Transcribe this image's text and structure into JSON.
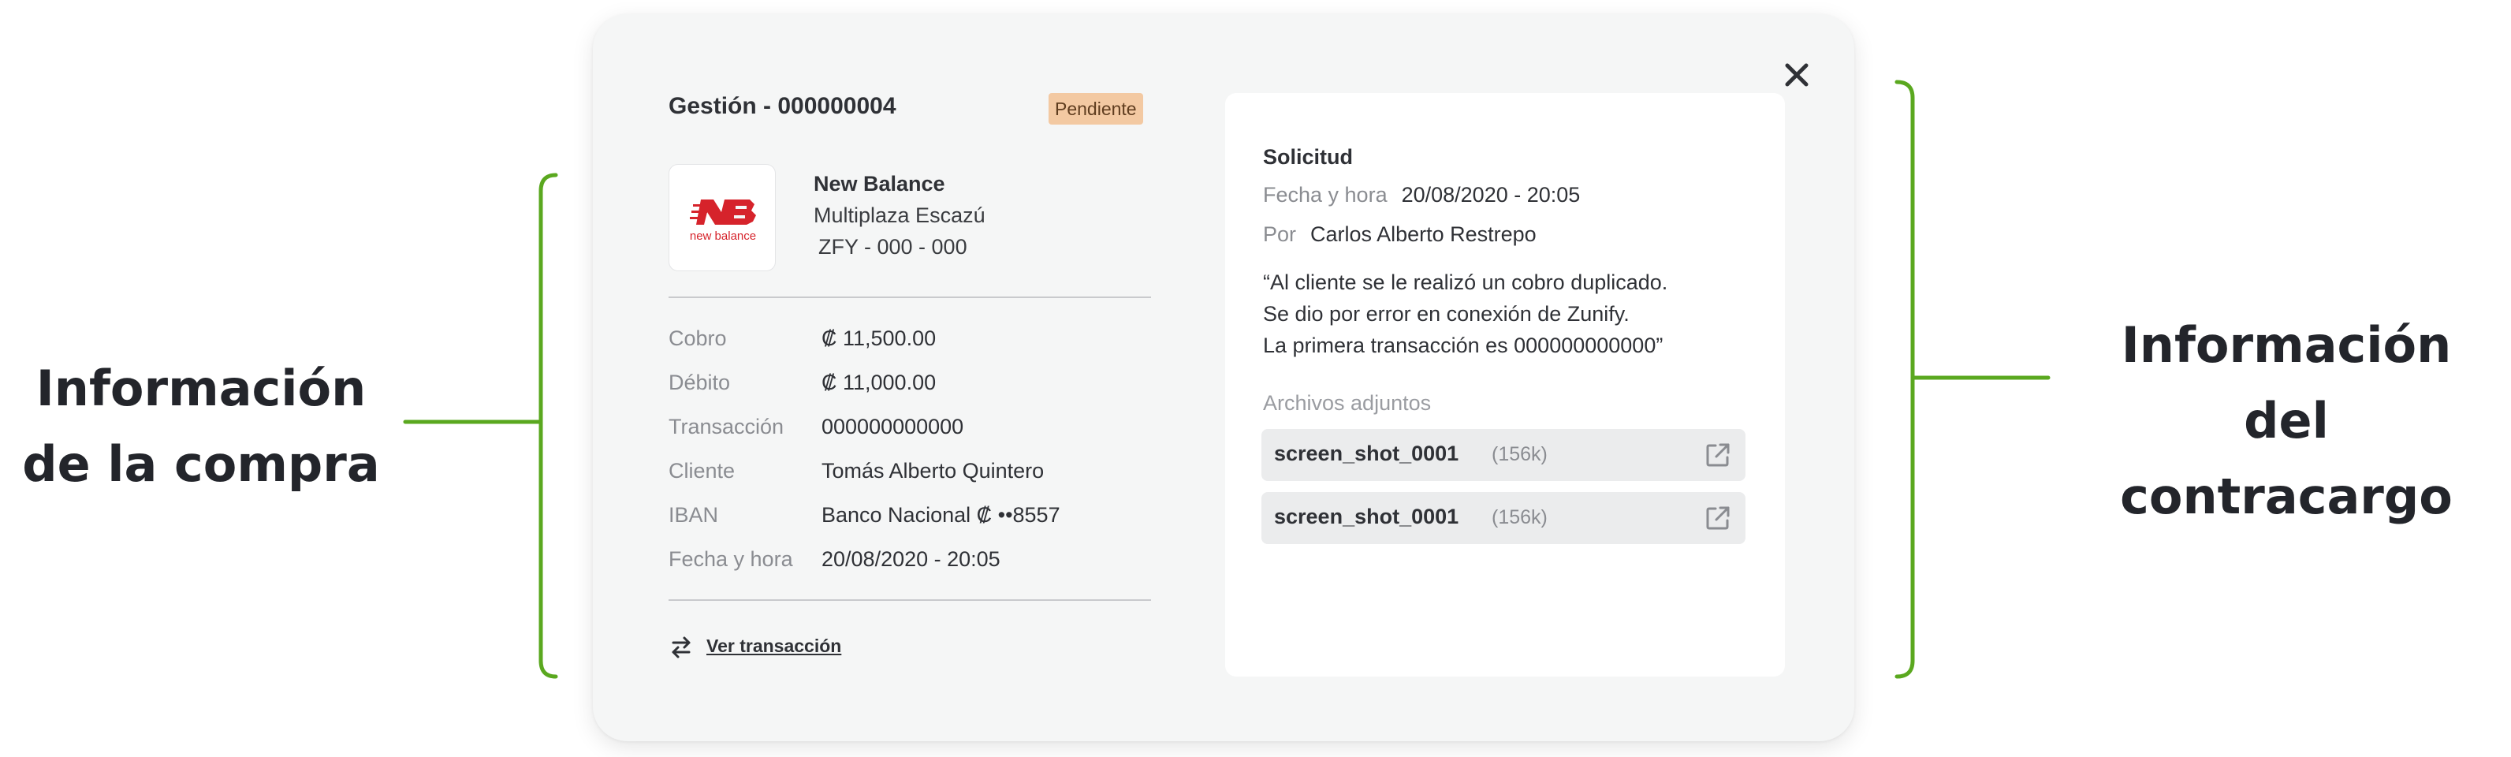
{
  "annotations": {
    "left_line1": "Información",
    "left_line2": "de la compra",
    "right_line1": "Información",
    "right_line2": "del contracargo",
    "bracket_color": "#5aa81f"
  },
  "modal": {
    "close_icon": "close-icon",
    "title": "Gestión - 000000004",
    "status_badge": "Pendiente",
    "merchant": {
      "logo_text": "new balance",
      "logo_mark": "NB",
      "name": "New Balance",
      "location": "Multiplaza Escazú",
      "code": "ZFY - 000 - 000"
    },
    "details": [
      {
        "label": "Cobro",
        "value": "₡ 11,500.00"
      },
      {
        "label": "Débito",
        "value": "₡ 11,000.00"
      },
      {
        "label": "Transacción",
        "value": "000000000000"
      },
      {
        "label": "Cliente",
        "value": "Tomás Alberto Quintero"
      },
      {
        "label": "IBAN",
        "value": "Banco Nacional ₡ ••8557"
      },
      {
        "label": "Fecha y hora",
        "value": "20/08/2020 - 20:05"
      }
    ],
    "see_transaction": "Ver transacción",
    "request": {
      "title": "Solicitud",
      "date_label": "Fecha y hora",
      "date_value": "20/08/2020 - 20:05",
      "by_label": "Por",
      "by_value": "Carlos Alberto Restrepo",
      "quote_line1": "“Al cliente se le realizó un cobro duplicado.",
      "quote_line2": "Se dio por error en conexión de Zunify.",
      "quote_line3": "La primera transacción es 000000000000”",
      "attachments_title": "Archivos adjuntos",
      "attachments": [
        {
          "name": "screen_shot_0001",
          "size": "(156k)"
        },
        {
          "name": "screen_shot_0001",
          "size": "(156k)"
        }
      ]
    }
  }
}
